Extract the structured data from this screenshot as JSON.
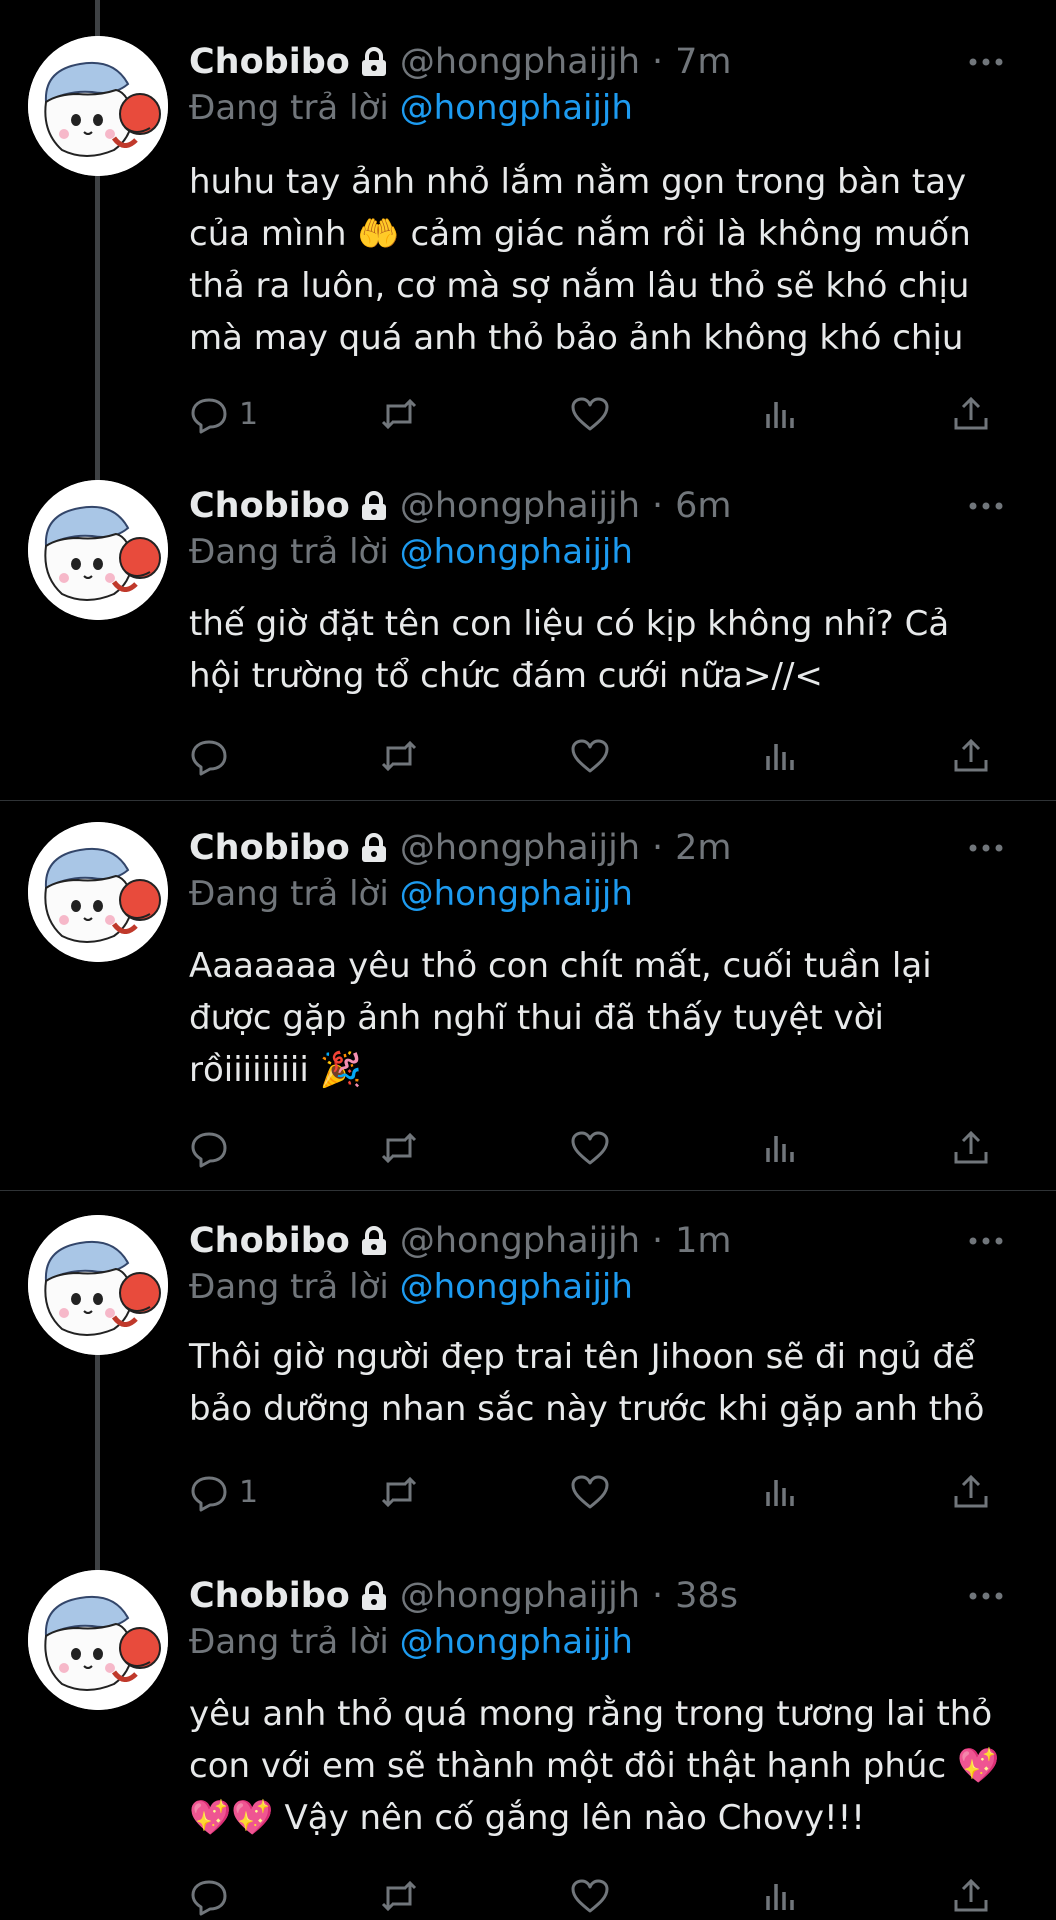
{
  "tweets": [
    {
      "name": "Chobibo",
      "handle": "@hongphaijjh",
      "dot": "·",
      "time": "7m",
      "reply_prefix": "Đang trả lời",
      "reply_to": "@hongphaijjh",
      "lines": [
        "huhu tay ảnh nhỏ lắm nằm gọn trong bàn tay",
        "của mình 🤲 cảm giác nắm rồi là không muốn",
        "thả ra luôn, cơ mà sợ nắm lâu thỏ sẽ khó chịu",
        "mà may quá anh thỏ bảo ảnh không khó chịu"
      ],
      "reply_count": "1"
    },
    {
      "name": "Chobibo",
      "handle": "@hongphaijjh",
      "dot": "·",
      "time": "6m",
      "reply_prefix": "Đang trả lời",
      "reply_to": "@hongphaijjh",
      "lines": [
        "thế giờ đặt tên con liệu có kịp không nhỉ? Cả",
        "hội trường tổ chức đám cưới nữa>//<"
      ],
      "reply_count": ""
    },
    {
      "name": "Chobibo",
      "handle": "@hongphaijjh",
      "dot": "·",
      "time": "2m",
      "reply_prefix": "Đang trả lời",
      "reply_to": "@hongphaijjh",
      "lines": [
        "Aaaaaaa yêu thỏ con chít mất, cuối tuần lại",
        "được gặp ảnh nghĩ thui đã thấy tuyệt vời",
        "rồiiiiiiiii 🎉"
      ],
      "reply_count": ""
    },
    {
      "name": "Chobibo",
      "handle": "@hongphaijjh",
      "dot": "·",
      "time": "1m",
      "reply_prefix": "Đang trả lời",
      "reply_to": "@hongphaijjh",
      "lines": [
        "Thôi giờ người đẹp trai tên Jihoon sẽ đi ngủ để",
        "bảo dưỡng nhan sắc này trước khi gặp anh thỏ"
      ],
      "reply_count": "1"
    },
    {
      "name": "Chobibo",
      "handle": "@hongphaijjh",
      "dot": "·",
      "time": "38s",
      "reply_prefix": "Đang trả lời",
      "reply_to": "@hongphaijjh",
      "lines": [
        "yêu anh thỏ quá mong rằng trong tương lai thỏ",
        "con với em sẽ thành một đôi thật hạnh phúc 💖",
        "💖💖 Vậy nên cố gắng lên nào Chovy!!!"
      ],
      "reply_count": ""
    }
  ],
  "icons": {
    "lock": "lock-icon",
    "more": "more-icon",
    "reply": "reply-icon",
    "retweet": "retweet-icon",
    "like": "like-icon",
    "views": "views-icon",
    "share": "share-icon"
  },
  "colors": {
    "background": "#000000",
    "text": "#e7e9ea",
    "muted": "#71767b",
    "mention": "#1d9bf0",
    "thread_line": "#3e4144"
  }
}
